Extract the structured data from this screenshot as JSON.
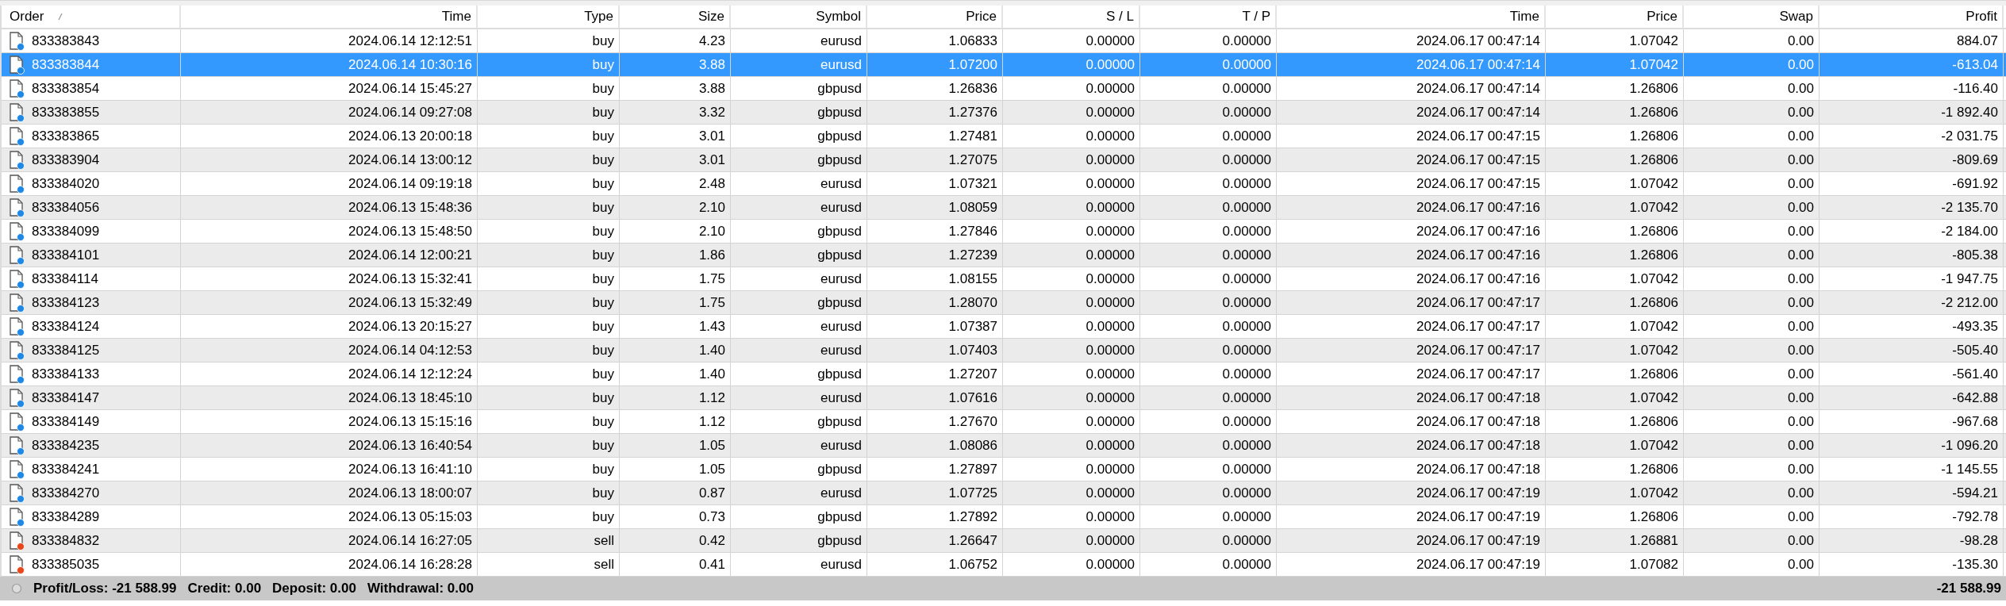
{
  "table": {
    "columns": [
      {
        "label": "Order",
        "sorted": true
      },
      {
        "label": "Time",
        "sorted": false
      },
      {
        "label": "Type",
        "sorted": false
      },
      {
        "label": "Size",
        "sorted": false
      },
      {
        "label": "Symbol",
        "sorted": false
      },
      {
        "label": "Price",
        "sorted": false
      },
      {
        "label": "S / L",
        "sorted": false
      },
      {
        "label": "T / P",
        "sorted": false
      },
      {
        "label": "Time",
        "sorted": false
      },
      {
        "label": "Price",
        "sorted": false
      },
      {
        "label": "Swap",
        "sorted": false
      },
      {
        "label": "Profit",
        "sorted": false
      }
    ],
    "rows": [
      {
        "kind": "buy",
        "selected": false,
        "cells": [
          "833383843",
          "2024.06.14 12:12:51",
          "buy",
          "4.23",
          "eurusd",
          "1.06833",
          "0.00000",
          "0.00000",
          "2024.06.17 00:47:14",
          "1.07042",
          "0.00",
          "884.07"
        ]
      },
      {
        "kind": "buy",
        "selected": true,
        "cells": [
          "833383844",
          "2024.06.14 10:30:16",
          "buy",
          "3.88",
          "eurusd",
          "1.07200",
          "0.00000",
          "0.00000",
          "2024.06.17 00:47:14",
          "1.07042",
          "0.00",
          "-613.04"
        ]
      },
      {
        "kind": "buy",
        "selected": false,
        "cells": [
          "833383854",
          "2024.06.14 15:45:27",
          "buy",
          "3.88",
          "gbpusd",
          "1.26836",
          "0.00000",
          "0.00000",
          "2024.06.17 00:47:14",
          "1.26806",
          "0.00",
          "-116.40"
        ]
      },
      {
        "kind": "buy",
        "selected": false,
        "cells": [
          "833383855",
          "2024.06.14 09:27:08",
          "buy",
          "3.32",
          "gbpusd",
          "1.27376",
          "0.00000",
          "0.00000",
          "2024.06.17 00:47:14",
          "1.26806",
          "0.00",
          "-1 892.40"
        ]
      },
      {
        "kind": "buy",
        "selected": false,
        "cells": [
          "833383865",
          "2024.06.13 20:00:18",
          "buy",
          "3.01",
          "gbpusd",
          "1.27481",
          "0.00000",
          "0.00000",
          "2024.06.17 00:47:15",
          "1.26806",
          "0.00",
          "-2 031.75"
        ]
      },
      {
        "kind": "buy",
        "selected": false,
        "cells": [
          "833383904",
          "2024.06.14 13:00:12",
          "buy",
          "3.01",
          "gbpusd",
          "1.27075",
          "0.00000",
          "0.00000",
          "2024.06.17 00:47:15",
          "1.26806",
          "0.00",
          "-809.69"
        ]
      },
      {
        "kind": "buy",
        "selected": false,
        "cells": [
          "833384020",
          "2024.06.14 09:19:18",
          "buy",
          "2.48",
          "eurusd",
          "1.07321",
          "0.00000",
          "0.00000",
          "2024.06.17 00:47:15",
          "1.07042",
          "0.00",
          "-691.92"
        ]
      },
      {
        "kind": "buy",
        "selected": false,
        "cells": [
          "833384056",
          "2024.06.13 15:48:36",
          "buy",
          "2.10",
          "eurusd",
          "1.08059",
          "0.00000",
          "0.00000",
          "2024.06.17 00:47:16",
          "1.07042",
          "0.00",
          "-2 135.70"
        ]
      },
      {
        "kind": "buy",
        "selected": false,
        "cells": [
          "833384099",
          "2024.06.13 15:48:50",
          "buy",
          "2.10",
          "gbpusd",
          "1.27846",
          "0.00000",
          "0.00000",
          "2024.06.17 00:47:16",
          "1.26806",
          "0.00",
          "-2 184.00"
        ]
      },
      {
        "kind": "buy",
        "selected": false,
        "cells": [
          "833384101",
          "2024.06.14 12:00:21",
          "buy",
          "1.86",
          "gbpusd",
          "1.27239",
          "0.00000",
          "0.00000",
          "2024.06.17 00:47:16",
          "1.26806",
          "0.00",
          "-805.38"
        ]
      },
      {
        "kind": "buy",
        "selected": false,
        "cells": [
          "833384114",
          "2024.06.13 15:32:41",
          "buy",
          "1.75",
          "eurusd",
          "1.08155",
          "0.00000",
          "0.00000",
          "2024.06.17 00:47:16",
          "1.07042",
          "0.00",
          "-1 947.75"
        ]
      },
      {
        "kind": "buy",
        "selected": false,
        "cells": [
          "833384123",
          "2024.06.13 15:32:49",
          "buy",
          "1.75",
          "gbpusd",
          "1.28070",
          "0.00000",
          "0.00000",
          "2024.06.17 00:47:17",
          "1.26806",
          "0.00",
          "-2 212.00"
        ]
      },
      {
        "kind": "buy",
        "selected": false,
        "cells": [
          "833384124",
          "2024.06.13 20:15:27",
          "buy",
          "1.43",
          "eurusd",
          "1.07387",
          "0.00000",
          "0.00000",
          "2024.06.17 00:47:17",
          "1.07042",
          "0.00",
          "-493.35"
        ]
      },
      {
        "kind": "buy",
        "selected": false,
        "cells": [
          "833384125",
          "2024.06.14 04:12:53",
          "buy",
          "1.40",
          "eurusd",
          "1.07403",
          "0.00000",
          "0.00000",
          "2024.06.17 00:47:17",
          "1.07042",
          "0.00",
          "-505.40"
        ]
      },
      {
        "kind": "buy",
        "selected": false,
        "cells": [
          "833384133",
          "2024.06.14 12:12:24",
          "buy",
          "1.40",
          "gbpusd",
          "1.27207",
          "0.00000",
          "0.00000",
          "2024.06.17 00:47:17",
          "1.26806",
          "0.00",
          "-561.40"
        ]
      },
      {
        "kind": "buy",
        "selected": false,
        "cells": [
          "833384147",
          "2024.06.13 18:45:10",
          "buy",
          "1.12",
          "eurusd",
          "1.07616",
          "0.00000",
          "0.00000",
          "2024.06.17 00:47:18",
          "1.07042",
          "0.00",
          "-642.88"
        ]
      },
      {
        "kind": "buy",
        "selected": false,
        "cells": [
          "833384149",
          "2024.06.13 15:15:16",
          "buy",
          "1.12",
          "gbpusd",
          "1.27670",
          "0.00000",
          "0.00000",
          "2024.06.17 00:47:18",
          "1.26806",
          "0.00",
          "-967.68"
        ]
      },
      {
        "kind": "buy",
        "selected": false,
        "cells": [
          "833384235",
          "2024.06.13 16:40:54",
          "buy",
          "1.05",
          "eurusd",
          "1.08086",
          "0.00000",
          "0.00000",
          "2024.06.17 00:47:18",
          "1.07042",
          "0.00",
          "-1 096.20"
        ]
      },
      {
        "kind": "buy",
        "selected": false,
        "cells": [
          "833384241",
          "2024.06.13 16:41:10",
          "buy",
          "1.05",
          "gbpusd",
          "1.27897",
          "0.00000",
          "0.00000",
          "2024.06.17 00:47:18",
          "1.26806",
          "0.00",
          "-1 145.55"
        ]
      },
      {
        "kind": "buy",
        "selected": false,
        "cells": [
          "833384270",
          "2024.06.13 18:00:07",
          "buy",
          "0.87",
          "eurusd",
          "1.07725",
          "0.00000",
          "0.00000",
          "2024.06.17 00:47:19",
          "1.07042",
          "0.00",
          "-594.21"
        ]
      },
      {
        "kind": "buy",
        "selected": false,
        "cells": [
          "833384289",
          "2024.06.13 05:15:03",
          "buy",
          "0.73",
          "gbpusd",
          "1.27892",
          "0.00000",
          "0.00000",
          "2024.06.17 00:47:19",
          "1.26806",
          "0.00",
          "-792.78"
        ]
      },
      {
        "kind": "sell",
        "selected": false,
        "cells": [
          "833384832",
          "2024.06.14 16:27:05",
          "sell",
          "0.42",
          "gbpusd",
          "1.26647",
          "0.00000",
          "0.00000",
          "2024.06.17 00:47:19",
          "1.26881",
          "0.00",
          "-98.28"
        ]
      },
      {
        "kind": "sell",
        "selected": false,
        "cells": [
          "833385035",
          "2024.06.14 16:28:28",
          "sell",
          "0.41",
          "eurusd",
          "1.06752",
          "0.00000",
          "0.00000",
          "2024.06.17 00:47:19",
          "1.07082",
          "0.00",
          "-135.30"
        ]
      }
    ]
  },
  "summary": {
    "items": [
      {
        "label": "Profit/Loss:",
        "value": "-21 588.99"
      },
      {
        "label": "Credit:",
        "value": "0.00"
      },
      {
        "label": "Deposit:",
        "value": "0.00"
      },
      {
        "label": "Withdrawal:",
        "value": "0.00"
      }
    ],
    "total": "-21 588.99"
  }
}
